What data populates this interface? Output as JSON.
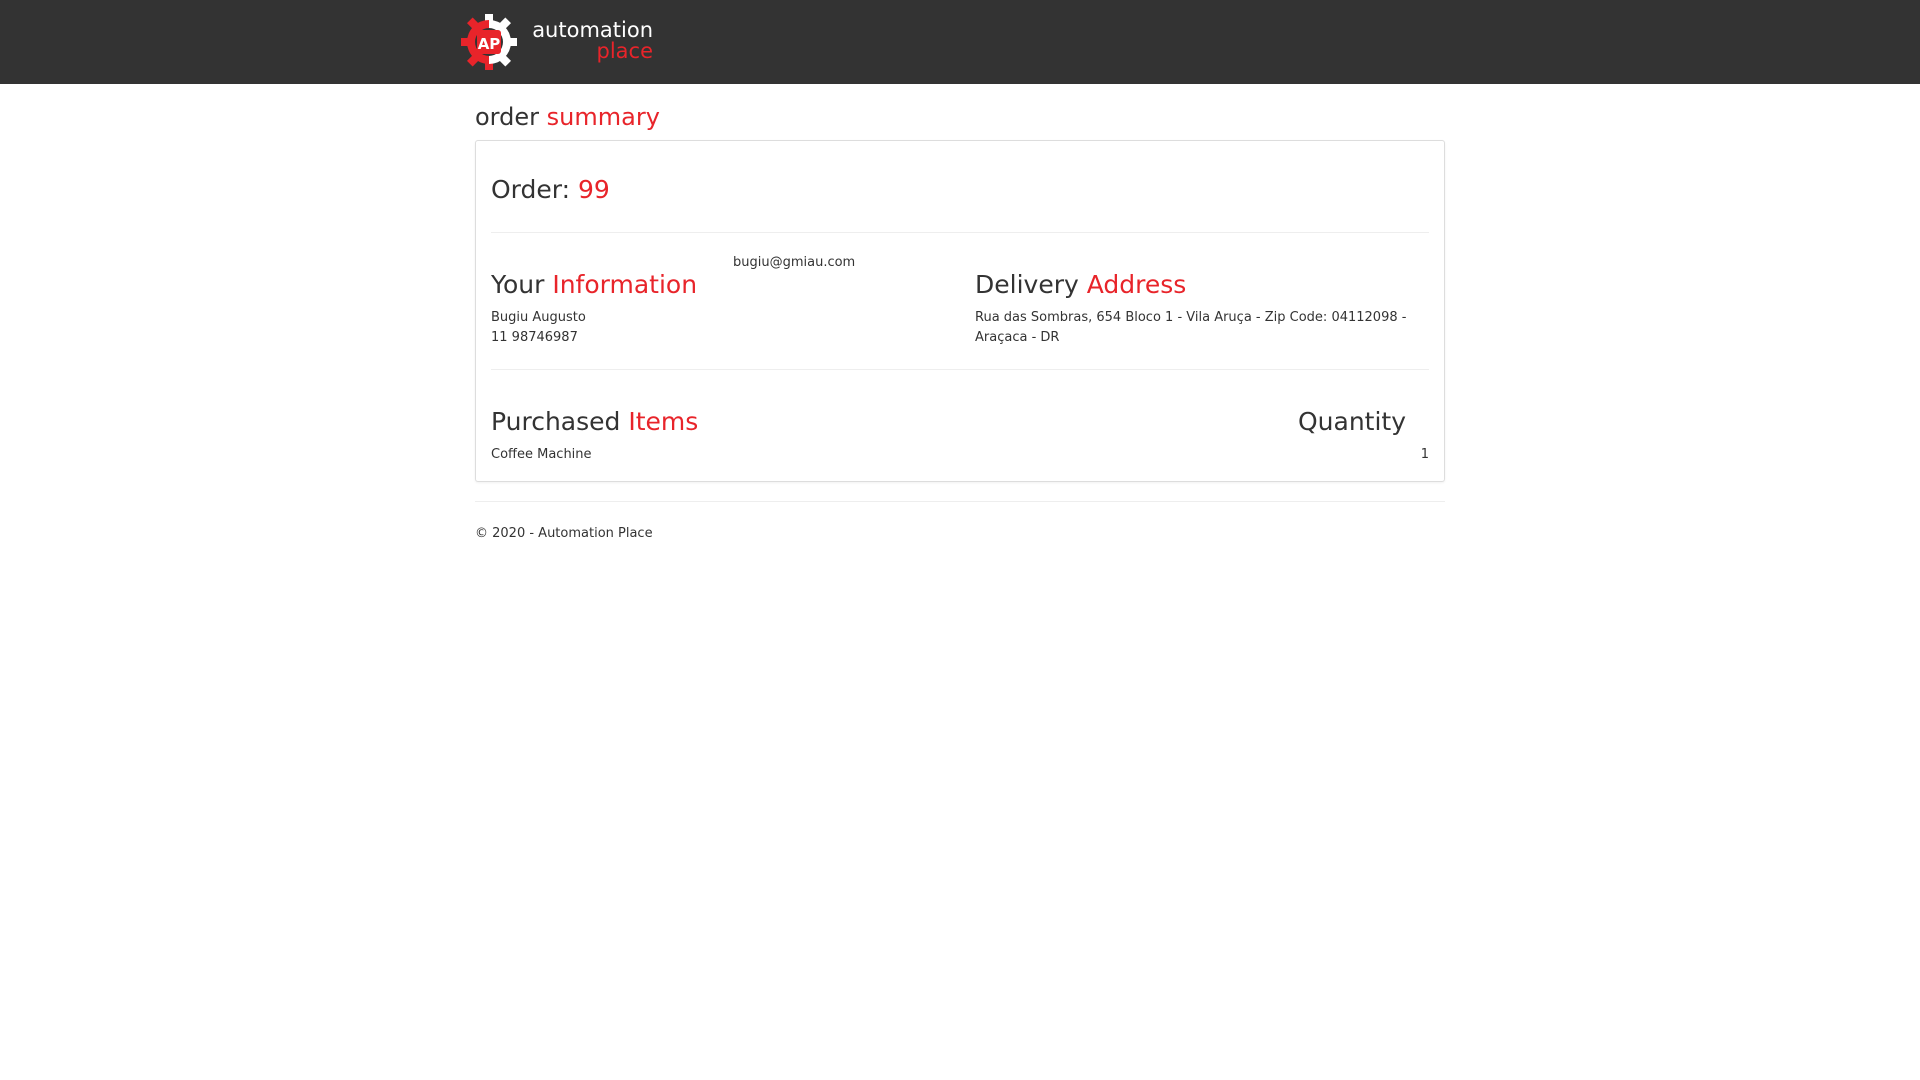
{
  "brand": {
    "line1": "automation",
    "line2": "place",
    "logo_letters": "AP",
    "logo_icon": "gear-icon"
  },
  "page_title": {
    "part1": "order",
    "part2": "summary"
  },
  "order": {
    "label": "Order:",
    "number": "99"
  },
  "customer": {
    "heading1": "Your",
    "heading2": "Information",
    "email": "bugiu@gmiau.com",
    "name": "Bugiu Augusto",
    "phone": "11 98746987"
  },
  "delivery": {
    "heading1": "Delivery",
    "heading2": "Address",
    "address": "Rua das Sombras, 654 Bloco 1 - Vila Aruça - Zip Code: 04112098 - Araçaca - DR"
  },
  "items": {
    "heading1": "Purchased",
    "heading2": "Items",
    "quantity_heading": "Quantity",
    "rows": [
      {
        "name": "Coffee Machine",
        "quantity": "1"
      }
    ]
  },
  "footer": {
    "text": "© 2020 - Automation Place"
  },
  "colors": {
    "accent": "#e8242a",
    "navbar": "#333333",
    "text": "#333333"
  }
}
